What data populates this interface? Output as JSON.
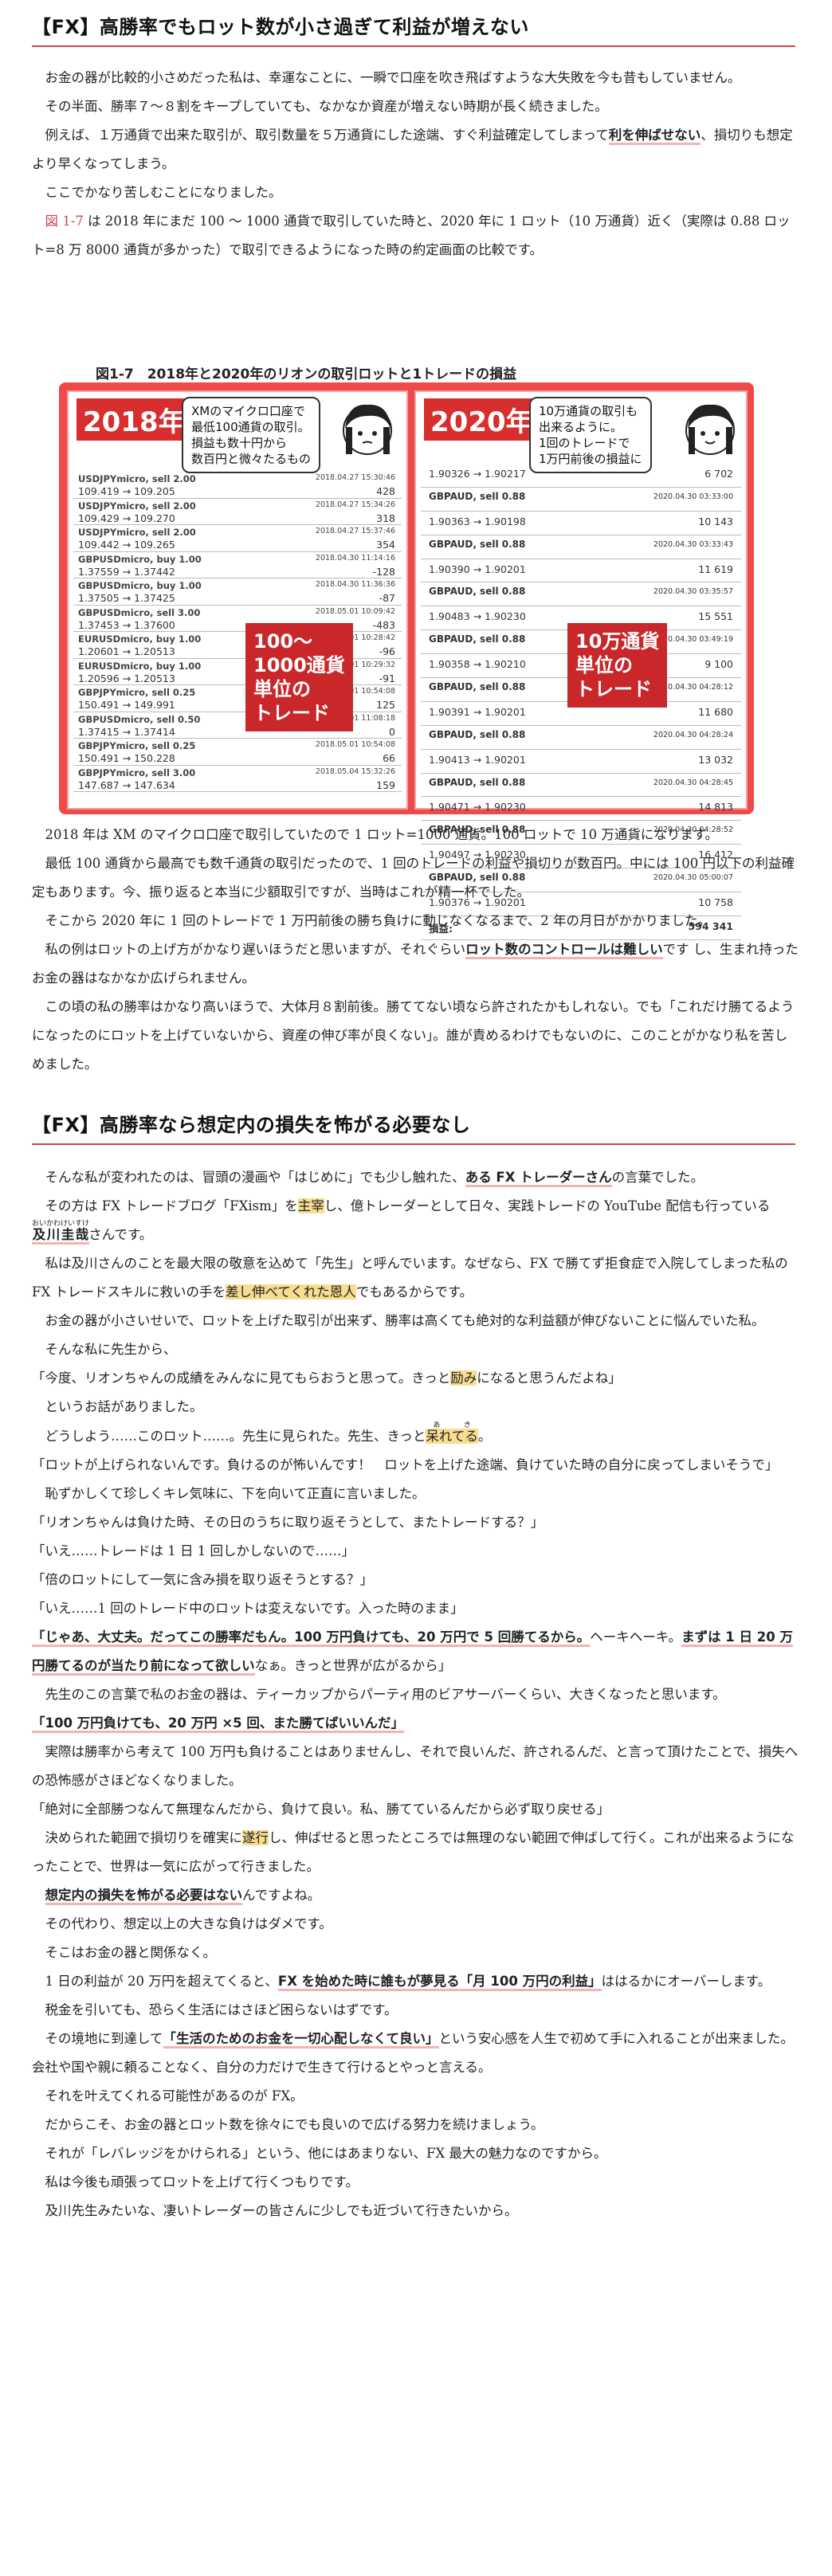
{
  "section1": {
    "heading": "【FX】高勝率でもロット数が小さ過ぎて利益が増えない",
    "p1": "お金の器が比較的小さめだった私は、幸運なことに、一瞬で口座を吹き飛ばすような大失敗を今も昔もしていません。",
    "p2": "その半面、勝率７～８割をキープしていても、なかなか資産が増えない時期が長く続きました。",
    "p3_a": "例えば、１万通貨で出来た取引が、取引数量を５万通貨にした途端、すぐ利益確定してしまって",
    "p3_b": "利を伸ばせない",
    "p3_c": "、損切りも想定より早くなってしまう。",
    "p4": "ここでかなり苦しむことになりました。",
    "p5_a": "図 1-7",
    "p5_b": " は 2018 年にまだ 100 ～ 1000 通貨で取引していた時と、2020 年に 1 ロット（10 万通貨）近く（実際は 0.88 ロット=8 万 8000 通貨が多かった）で取引できるようになった時の約定画面の比較です。"
  },
  "figure": {
    "caption": "図1-7　2018年と2020年のリオンの取引ロットと1トレードの損益",
    "left": {
      "year": "2018年",
      "bubble": "XMのマイクロ口座で\n最低100通貨の取引。\n損益も数十円から\n数百円と微々たるもの",
      "label": "100～\n1000通貨\n単位の\nトレード",
      "rows": [
        {
          "pair": "USDJPYmicro, sell 2.00",
          "prices": "109.419 → 109.205",
          "date": "2018.04.27 15:30:46",
          "pl": "428"
        },
        {
          "pair": "USDJPYmicro, sell 2.00",
          "prices": "109.429 → 109.270",
          "date": "2018.04.27 15:34:26",
          "pl": "318"
        },
        {
          "pair": "USDJPYmicro, sell 2.00",
          "prices": "109.442 → 109.265",
          "date": "2018.04.27 15:37:46",
          "pl": "354"
        },
        {
          "pair": "GBPUSDmicro, buy 1.00",
          "prices": "1.37559 → 1.37442",
          "date": "2018.04.30 11:14:16",
          "pl": "-128"
        },
        {
          "pair": "GBPUSDmicro, buy 1.00",
          "prices": "1.37505 → 1.37425",
          "date": "2018.04.30 11:36:36",
          "pl": "-87"
        },
        {
          "pair": "GBPUSDmicro, sell 3.00",
          "prices": "1.37453 → 1.37600",
          "date": "2018.05.01 10:09:42",
          "pl": "-483"
        },
        {
          "pair": "EURUSDmicro, buy 1.00",
          "prices": "1.20601 → 1.20513",
          "date": "2018.05.01 10:28:42",
          "pl": "-96"
        },
        {
          "pair": "EURUSDmicro, buy 1.00",
          "prices": "1.20596 → 1.20513",
          "date": "2018.05.01 10:29:32",
          "pl": "-91"
        },
        {
          "pair": "GBPJPYmicro, sell 0.25",
          "prices": "150.491 → 149.991",
          "date": "2018.05.01 10:54:08",
          "pl": "125"
        },
        {
          "pair": "GBPUSDmicro, sell 0.50",
          "prices": "1.37415 → 1.37414",
          "date": "2018.05.01 11:08:18",
          "pl": "0"
        },
        {
          "pair": "GBPJPYmicro, sell 0.25",
          "prices": "150.491 → 150.228",
          "date": "2018.05.01 10:54:08",
          "pl": "66"
        },
        {
          "pair": "GBPJPYmicro, sell 3.00",
          "prices": "147.687 → 147.634",
          "date": "2018.05.04 15:32:26",
          "pl": "159"
        }
      ]
    },
    "right": {
      "year": "2020年",
      "bubble": "10万通貨の取引も\n出来るように。\n1回のトレードで\n1万円前後の損益に",
      "label": "10万通貨\n単位の\nトレード",
      "rows": [
        {
          "t": "p",
          "prices": "1.90326 → 1.90217",
          "pl": "6 702"
        },
        {
          "t": "h",
          "pair": "GBPAUD, sell 0.88",
          "date": "2020.04.30 03:33:00"
        },
        {
          "t": "p",
          "prices": "1.90363 → 1.90198",
          "pl": "10 143"
        },
        {
          "t": "h",
          "pair": "GBPAUD, sell 0.88",
          "date": "2020.04.30 03:33:43"
        },
        {
          "t": "p",
          "prices": "1.90390 → 1.90201",
          "pl": "11 619"
        },
        {
          "t": "h",
          "pair": "GBPAUD, sell 0.88",
          "date": "2020.04.30 03:35:57"
        },
        {
          "t": "p",
          "prices": "1.90483 → 1.90230",
          "pl": "15 551"
        },
        {
          "t": "h",
          "pair": "GBPAUD, sell 0.88",
          "date": "2020.04.30 03:49:19"
        },
        {
          "t": "p",
          "prices": "1.90358 → 1.90210",
          "pl": "9 100"
        },
        {
          "t": "h",
          "pair": "GBPAUD, sell 0.88",
          "date": "2020.04.30 04:28:12"
        },
        {
          "t": "p",
          "prices": "1.90391 → 1.90201",
          "pl": "11 680"
        },
        {
          "t": "h",
          "pair": "GBPAUD, sell 0.88",
          "date": "2020.04.30 04:28:24"
        },
        {
          "t": "p",
          "prices": "1.90413 → 1.90201",
          "pl": "13 032"
        },
        {
          "t": "h",
          "pair": "GBPAUD, sell 0.88",
          "date": "2020.04.30 04:28:45"
        },
        {
          "t": "p",
          "prices": "1.90471 → 1.90230",
          "pl": "14 813"
        },
        {
          "t": "h",
          "pair": "GBPAUD, sell 0.88",
          "date": "2020.04.30 04:28:52"
        },
        {
          "t": "p",
          "prices": "1.90497 → 1.90230",
          "pl": "16 412"
        },
        {
          "t": "h",
          "pair": "GBPAUD, sell 0.88",
          "date": "2020.04.30 05:00:07"
        },
        {
          "t": "p",
          "prices": "1.90376 → 1.90201",
          "pl": "10 758"
        },
        {
          "t": "p",
          "prices": "損益:",
          "pl": "594 341"
        }
      ]
    }
  },
  "section1b": {
    "p1": "2018 年は XM のマイクロ口座で取引していたので 1 ロット=1000 通貨。100 ロットで 10 万通貨になります。",
    "p2": "最低 100 通貨から最高でも数千通貨の取引だったので、1 回のトレードの利益や損切りが数百円。中には 100 円以下の利益確定もあります。今、振り返ると本当に少額取引ですが、当時はこれが精一杯でした。",
    "p3": "そこから 2020 年に 1 回のトレードで 1 万円前後の勝ち負けに動じなくなるまで、2 年の月日がかかりました。",
    "p4_a": "私の例はロットの上げ方がかなり遅いほうだと思いますが、それぐらい",
    "p4_b": "ロット数のコントロールは難しい",
    "p4_c": "です し、生まれ持ったお金の器はなかなか広げられません。",
    "p5": "この頃の私の勝率はかなり高いほうで、大体月８割前後。勝ててない頃なら許されたかもしれない。でも「これだけ勝てるようになったのにロットを上げていないから、資産の伸び率が良くない」。誰が責めるわけでもないのに、このことがかなり私を苦しめました。"
  },
  "section2": {
    "heading": "【FX】高勝率なら想定内の損失を怖がる必要なし",
    "p1_a": "そんな私が変われたのは、冒頭の漫画や「はじめに」でも少し触れた、",
    "p1_b": "ある FX トレーダーさん",
    "p1_c": "の言葉でした。",
    "p2_a": "その方は FX トレードブログ「FXism」を",
    "p2_b": "主宰",
    "p2_c": "し、億トレーダーとして日々、実践トレードの YouTube 配信も行っている",
    "p2_d": "及川圭哉",
    "p2_ruby": "おいかわけいすけ",
    "p2_e": "さんです。",
    "p3_a": "私は及川さんのことを最大限の敬意を込めて「先生」と呼んでいます。なぜなら、FX で勝てず拒食症で入院してしまった私の FX トレードスキルに救いの手を",
    "p3_b": "差し伸べてくれた恩人",
    "p3_c": "でもあるからです。",
    "p4": "お金の器が小さいせいで、ロットを上げた取引が出来ず、勝率は高くても絶対的な利益額が伸びないことに悩んでいた私。",
    "p5": "そんな私に先生から、",
    "p6_a": "「今度、リオンちゃんの成績をみんなに見てもらおうと思って。きっと",
    "p6_b": "励み",
    "p6_c": "になると思うんだよね」",
    "p7": "というお話がありました。",
    "p8_a": "どうしよう……このロット……。先生に見られた。先生、きっと",
    "p8_b": "呆れてる",
    "p8_ruby": "あき",
    "p8_c": "。",
    "p9": "「ロットが上げられないんです。負けるのが怖いんです！　ロットを上げた途端、負けていた時の自分に戻ってしまいそうで」",
    "p10": "恥ずかしくて珍しくキレ気味に、下を向いて正直に言いました。",
    "p11": "「リオンちゃんは負けた時、その日のうちに取り返そうとして、またトレードする？」",
    "p12": "「いえ……トレードは 1 日 1 回しかしないので……」",
    "p13": "「倍のロットにして一気に含み損を取り返そうとする？」",
    "p14": "「いえ……1 回のトレード中のロットは変えないです。入った時のまま」",
    "p15_a": "「じゃあ、大丈夫。だってこの勝率だもん。100 万円負けても、20 万円で 5 回勝てるから。",
    "p15_b": "ヘーキヘーキ。",
    "p15_c": "まずは 1 日 20 万円勝てるのが当たり前になって欲しい",
    "p15_d": "なぁ。きっと世界が広がるから」",
    "p16": "先生のこの言葉で私のお金の器は、ティーカップからパーティ用のビアサーバーくらい、大きくなったと思います。",
    "p17": "「100 万円負けても、20 万円 ×5 回、また勝てばいいんだ」",
    "p18": "実際は勝率から考えて 100 万円も負けることはありませんし、それで良いんだ、許されるんだ、と言って頂けたことで、損失への恐怖感がさほどなくなりました。",
    "p19": "「絶対に全部勝つなんて無理なんだから、負けて良い。私、勝てているんだから必ず取り戻せる」",
    "p20_a": "決められた範囲で損切りを確実に",
    "p20_b": "遂行",
    "p20_c": "し、伸ばせると思ったところでは無理のない範囲で伸ばして行く。これが出来るようになったことで、世界は一気に広がって行きました。",
    "p21_a": "想定内の損失を怖がる必要はない",
    "p21_b": "んですよね。",
    "p22": "その代わり、想定以上の大きな負けはダメです。",
    "p23": "そこはお金の器と関係なく。",
    "p24_a": "1 日の利益が 20 万円を超えてくると、",
    "p24_b": "FX を始めた時に誰もが夢見る「月 100 万円の利益」",
    "p24_c": "ははるかにオーバーします。",
    "p25": "税金を引いても、恐らく生活にはさほど困らないはずです。",
    "p26_a": "その境地に到達して",
    "p26_b": "「生活のためのお金を一切心配しなくて良い」",
    "p26_c": "という安心感を人生で初めて手に入れることが出来ました。会社や国や親に頼ることなく、自分の力だけで生きて行けるとやっと言える。",
    "p27": "それを叶えてくれる可能性があるのが FX。",
    "p28": "だからこそ、お金の器とロット数を徐々にでも良いので広げる努力を続けましょう。",
    "p29": "それが「レバレッジをかけられる」という、他にはあまりない、FX 最大の魅力なのですから。",
    "p30": "私は今後も頑張ってロットを上げて行くつもりです。",
    "p31": "及川先生みたいな、凄いトレーダーの皆さんに少しでも近づいて行きたいから。"
  }
}
